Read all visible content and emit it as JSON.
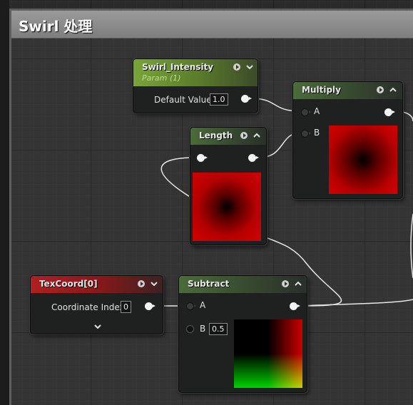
{
  "comment": {
    "title": "Swirl 处理"
  },
  "nodes": {
    "swirl_intensity": {
      "title": "Swirl_Intensity",
      "subtitle": "Param (1)",
      "default_label": "Default Value",
      "default_value": "1.0"
    },
    "multiply": {
      "title": "Multiply",
      "input_a": "A",
      "input_b": "B"
    },
    "length": {
      "title": "Length"
    },
    "texcoord": {
      "title": "TexCoord[0]",
      "coord_label": "Coordinate Index",
      "coord_value": "0"
    },
    "subtract": {
      "title": "Subtract",
      "input_a": "A",
      "input_b": "B",
      "b_value": "0.5"
    }
  },
  "colors": {
    "material_header": "#4c6b3a",
    "param_header": "#7aa43a",
    "texcoord_header": "#b02020",
    "wire": "#e6e6e6"
  },
  "icons": [
    "preview-play-icon",
    "collapse-chevron-icon",
    "expand-chevron-icon"
  ]
}
